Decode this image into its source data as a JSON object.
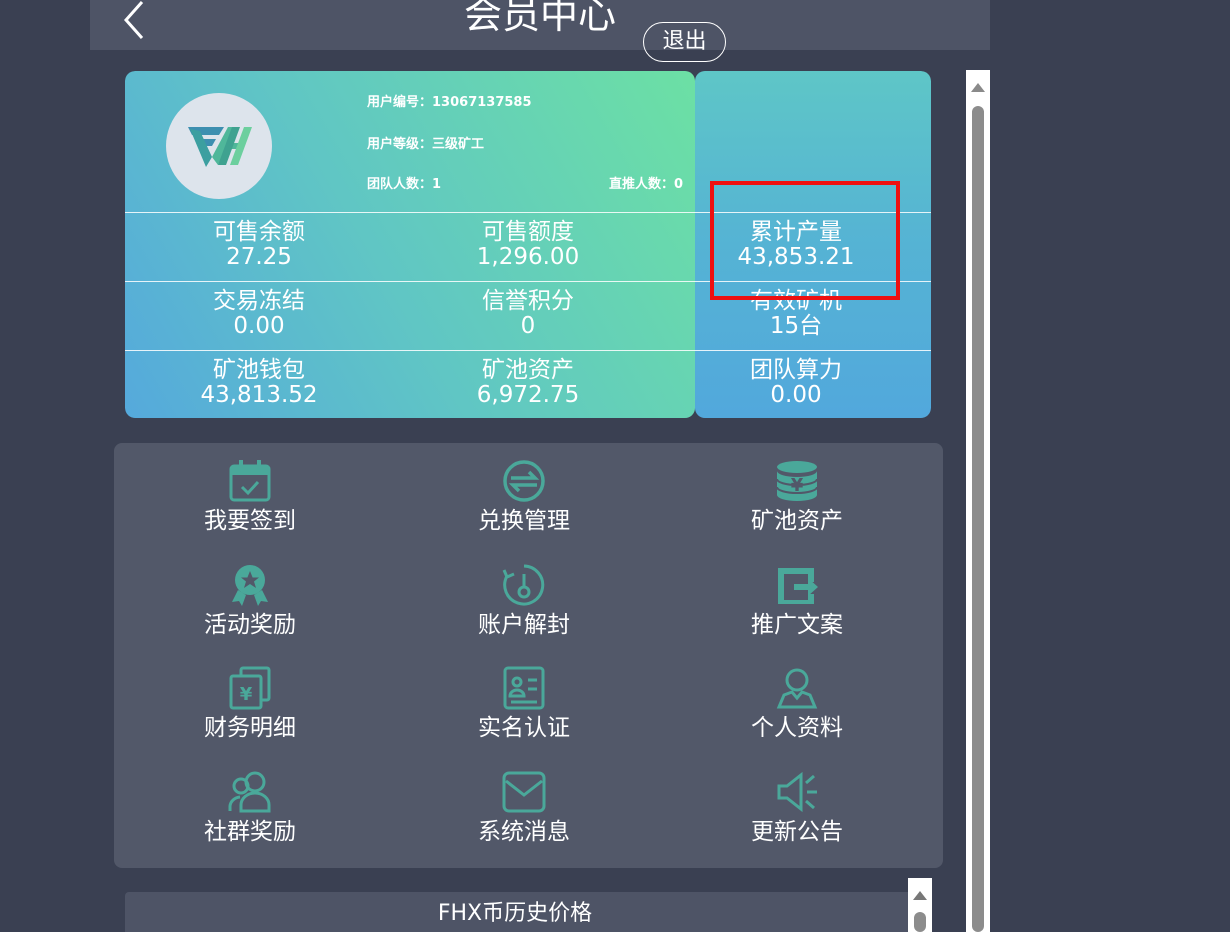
{
  "header": {
    "title": "会员中心"
  },
  "profile": {
    "user_id_label": "用户编号：",
    "user_id": "13067137585",
    "level_label": "用户等级：",
    "level": "三级矿工",
    "team_count_label": "团队人数：",
    "team_count": "1",
    "direct_count_label": "直推人数：",
    "direct_count": "0",
    "logout_label": "退出"
  },
  "stats": [
    {
      "label": "可售余额",
      "value": "27.25"
    },
    {
      "label": "可售额度",
      "value": "1,296.00"
    },
    {
      "label": "累计产量",
      "value": "43,853.21"
    },
    {
      "label": "交易冻结",
      "value": "0.00"
    },
    {
      "label": "信誉积分",
      "value": "0"
    },
    {
      "label": "有效矿机",
      "value": "15台"
    },
    {
      "label": "矿池钱包",
      "value": "43,813.52"
    },
    {
      "label": "矿池资产",
      "value": "6,972.75"
    },
    {
      "label": "团队算力",
      "value": "0.00"
    }
  ],
  "menu": [
    {
      "label": "我要签到",
      "icon": "calendar-check-icon"
    },
    {
      "label": "兑换管理",
      "icon": "exchange-icon"
    },
    {
      "label": "矿池资产",
      "icon": "coin-stack-icon"
    },
    {
      "label": "活动奖励",
      "icon": "award-badge-icon"
    },
    {
      "label": "账户解封",
      "icon": "unlock-key-icon"
    },
    {
      "label": "推广文案",
      "icon": "share-export-icon"
    },
    {
      "label": "财务明细",
      "icon": "yuan-ledger-icon"
    },
    {
      "label": "实名认证",
      "icon": "id-card-icon"
    },
    {
      "label": "个人资料",
      "icon": "user-profile-icon"
    },
    {
      "label": "社群奖励",
      "icon": "group-users-icon"
    },
    {
      "label": "系统消息",
      "icon": "envelope-icon"
    },
    {
      "label": "更新公告",
      "icon": "megaphone-icon"
    }
  ],
  "history": {
    "title": "FHX币历史价格"
  },
  "colors": {
    "accent": "#4aa89a",
    "highlight": "#ee1010",
    "panel": "#525869",
    "background": "#3a4052"
  }
}
